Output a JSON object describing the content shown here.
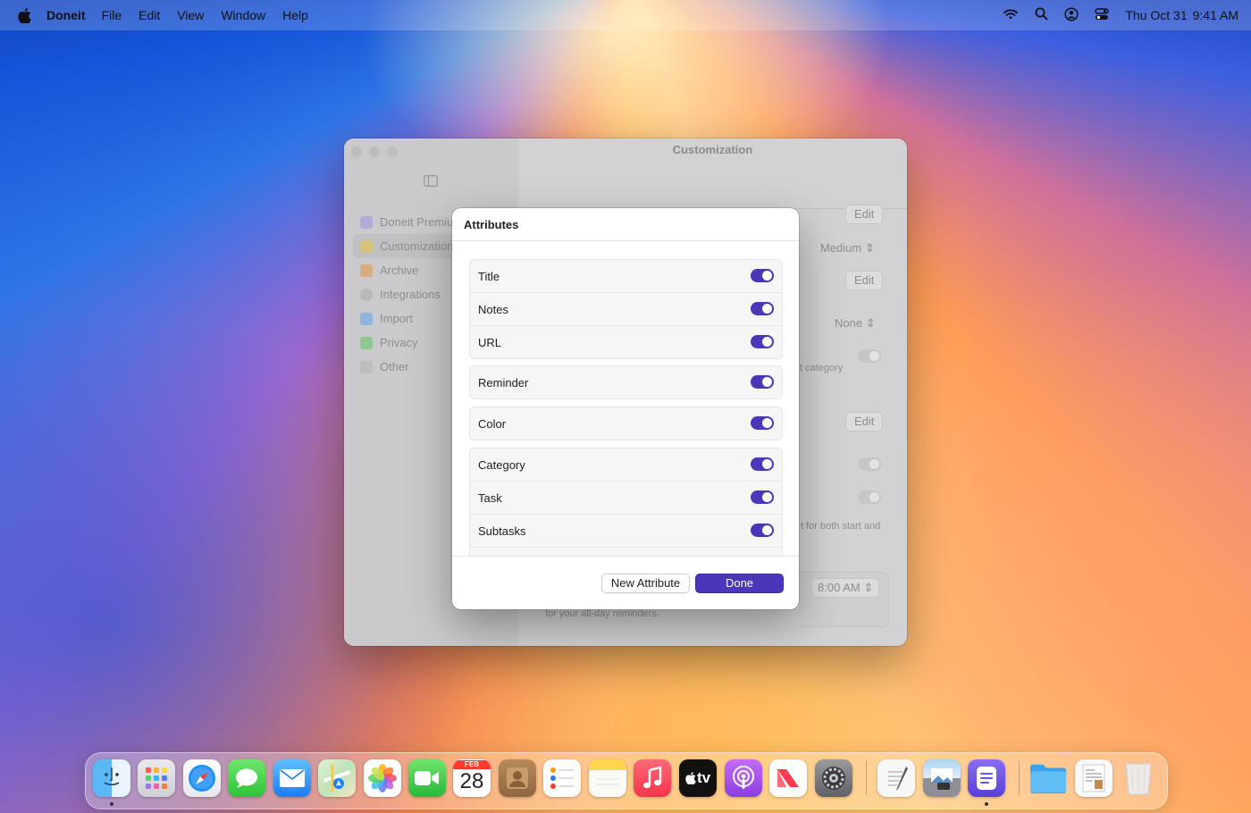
{
  "menubar": {
    "app_name": "Doneit",
    "items": [
      "File",
      "Edit",
      "View",
      "Window",
      "Help"
    ],
    "date": "Thu Oct 31",
    "time": "9:41 AM"
  },
  "window": {
    "title": "Customization",
    "sidebar": [
      {
        "label": "Doneit Premium",
        "icon": "crown-icon",
        "color": "#9a8fd6"
      },
      {
        "label": "Customization",
        "icon": "brush-icon",
        "color": "#e8c456",
        "selected": true
      },
      {
        "label": "Archive",
        "icon": "archive-icon",
        "color": "#e8a85a"
      },
      {
        "label": "Integrations",
        "icon": "gear-icon",
        "color": "#a8a8aa"
      },
      {
        "label": "Import",
        "icon": "import-icon",
        "color": "#6fa8e8"
      },
      {
        "label": "Privacy",
        "icon": "hand-icon",
        "color": "#6fcf6f"
      },
      {
        "label": "Other",
        "icon": "doc-icon",
        "color": "#b0b0b2"
      }
    ],
    "content": {
      "edit_label": "Edit",
      "priority_value": "Medium",
      "none_value": "None",
      "category_hint": "t category",
      "both_hint": "t for both start and",
      "time_value": "8:00 AM",
      "allday_hint": "for your all-day reminders."
    }
  },
  "sheet": {
    "title": "Attributes",
    "groups": [
      {
        "rows": [
          "Title",
          "Notes",
          "URL"
        ]
      },
      {
        "rows": [
          "Reminder"
        ]
      },
      {
        "rows": [
          "Color"
        ]
      },
      {
        "rows": [
          "Category",
          "Task",
          "Subtasks"
        ]
      }
    ],
    "new_attribute_label": "New Attribute",
    "done_label": "Done",
    "accent": "#4a36b8"
  },
  "dock": {
    "apps": [
      "Finder",
      "Launchpad",
      "Safari",
      "Messages",
      "Mail",
      "Maps",
      "Photos",
      "FaceTime",
      "Calendar",
      "Contacts",
      "Reminders",
      "Notes",
      "Music",
      "TV",
      "Podcasts",
      "News",
      "System Settings",
      "TextEdit",
      "Preview",
      "Doneit",
      "Downloads",
      "Document",
      "Trash"
    ],
    "calendar_month": "FEB",
    "calendar_day": "28",
    "tv_label": "tv"
  }
}
